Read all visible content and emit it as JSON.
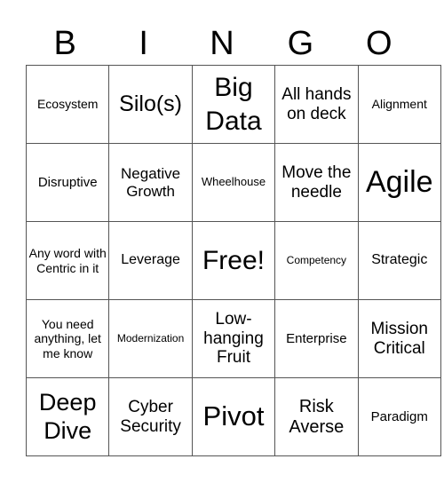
{
  "header": {
    "letters": [
      "B",
      "I",
      "N",
      "G",
      "O"
    ]
  },
  "rows": [
    [
      "Ecosystem",
      "Silo(s)",
      "Big Data",
      "All hands on deck",
      "Alignment"
    ],
    [
      "Disruptive",
      "Negative Growth",
      "Wheelhouse",
      "Move the needle",
      "Agile"
    ],
    [
      "Any word with Centric in it",
      "Leverage",
      "Free!",
      "Competency",
      "Strategic"
    ],
    [
      "You need anything, let me know",
      "Modernization",
      "Low-hanging Fruit",
      "Enterprise",
      "Mission Critical"
    ],
    [
      "Deep Dive",
      "Cyber Security",
      "Pivot",
      "Risk Averse",
      "Paradigm"
    ]
  ]
}
